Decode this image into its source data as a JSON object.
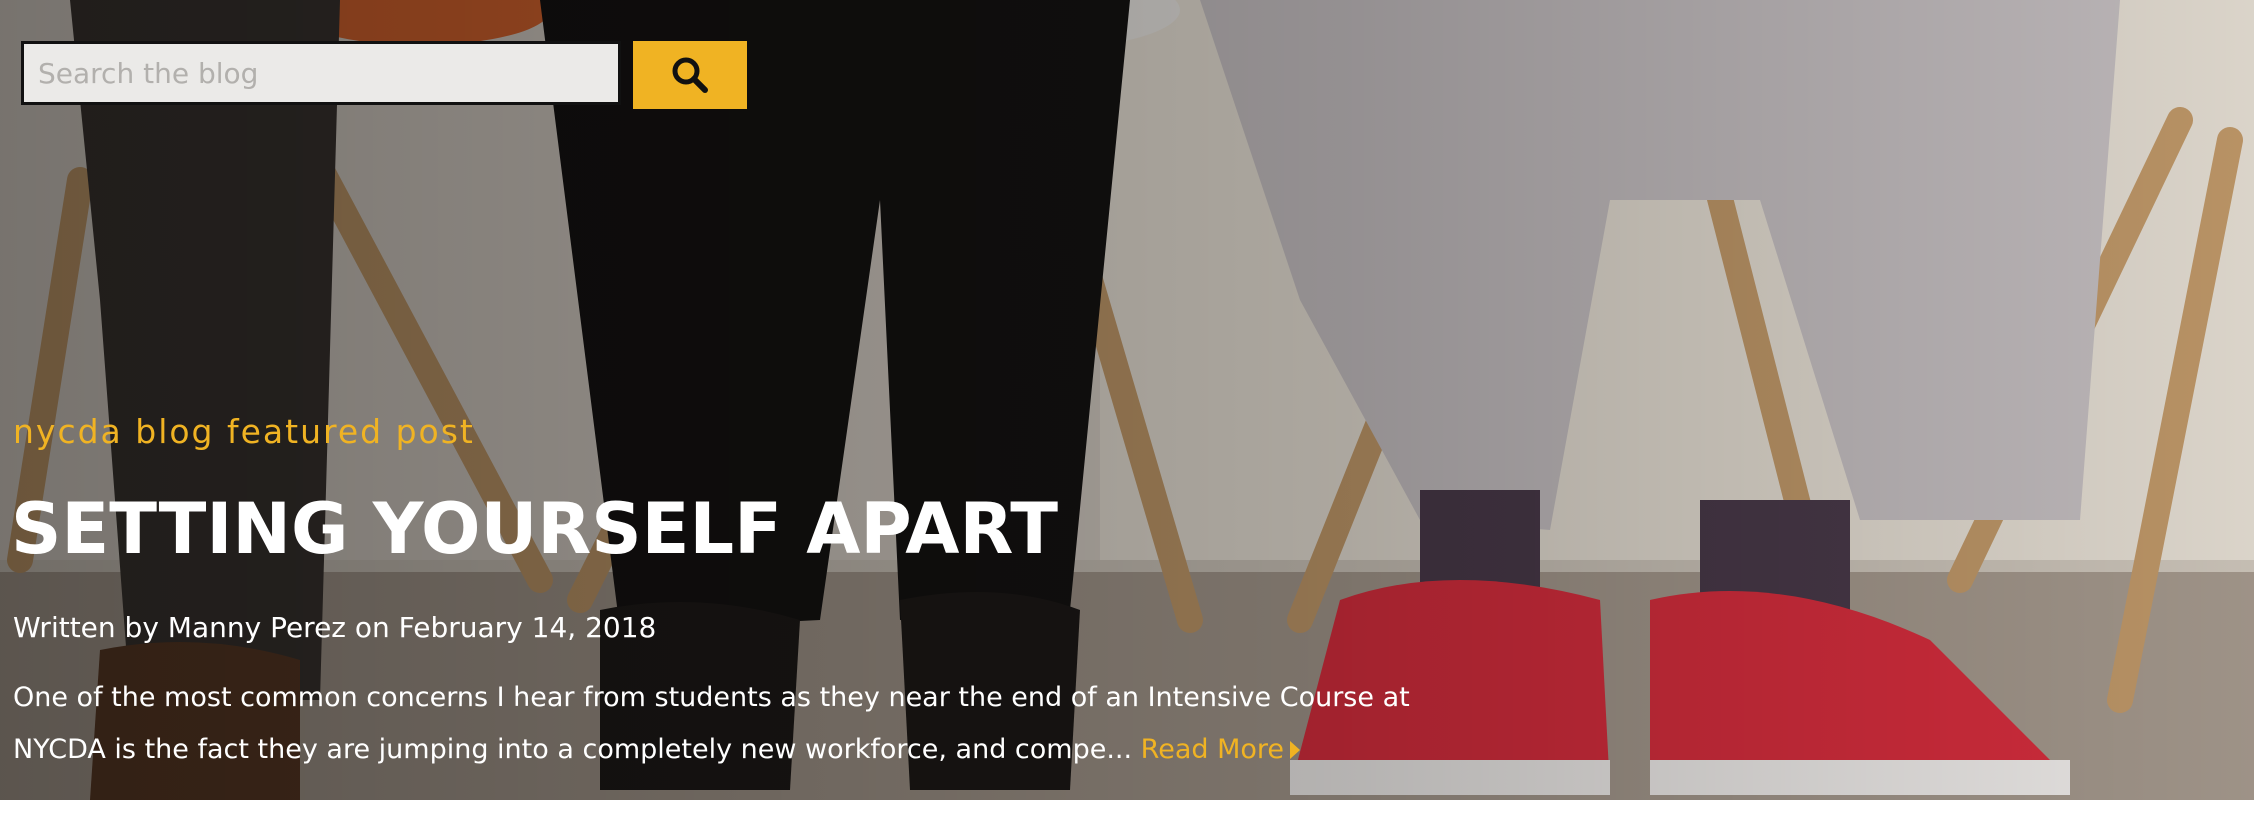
{
  "search": {
    "placeholder": "Search the blog",
    "button_icon": "search-icon"
  },
  "featured": {
    "kicker": "nycda blog featured post",
    "title": "SETTING YOURSELF APART",
    "byline": "Written by Manny Perez on February 14, 2018",
    "excerpt": "One of the most common concerns I hear from students as they near the end of an Intensive Course at NYCDA is the fact they are jumping into a completely new workforce, and compe...",
    "read_more": "Read More",
    "read_more_icon": "caret-right-icon"
  },
  "colors": {
    "accent": "#f0b323",
    "text_on_image": "#ffffff"
  }
}
